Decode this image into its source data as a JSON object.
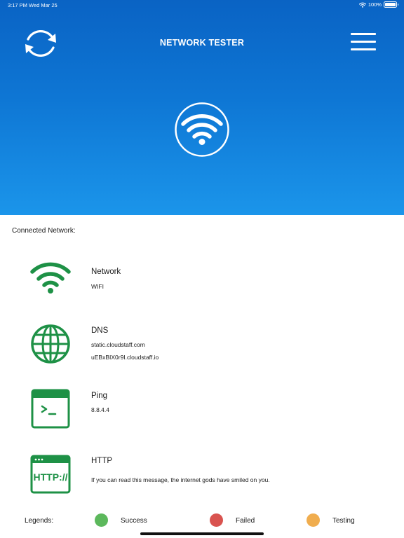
{
  "status_bar": {
    "time": "3:17 PM",
    "date": "Wed Mar 25",
    "battery": "100%",
    "battery_level": 1.0
  },
  "header": {
    "title": "NETWORK TESTER",
    "refresh_icon": "refresh-icon",
    "menu_icon": "hamburger-menu-icon",
    "status_icon": "wifi-icon"
  },
  "connected": {
    "label": "Connected Network:"
  },
  "items": [
    {
      "name": "Network",
      "icon": "wifi-icon",
      "values": [
        "WIFI"
      ]
    },
    {
      "name": "DNS",
      "icon": "globe-icon",
      "values": [
        "static.cloudstaff.com",
        "uEBxBIX0r9I.cloudstaff.io"
      ]
    },
    {
      "name": "Ping",
      "icon": "terminal-icon",
      "values": [
        "8.8.4.4"
      ]
    },
    {
      "name": "HTTP",
      "icon": "http-browser-icon",
      "values": [
        "If you can read this message, the internet gods have smiled on you."
      ]
    }
  ],
  "legend": {
    "title": "Legends:",
    "entries": [
      {
        "label": "Success",
        "color": "#5cb85c"
      },
      {
        "label": "Failed",
        "color": "#d9534f"
      },
      {
        "label": "Testing",
        "color": "#f0ad4e"
      }
    ]
  },
  "colors": {
    "header_top": "#0a63c4",
    "header_bottom": "#1b95ea",
    "status_success": "#1e9146"
  }
}
